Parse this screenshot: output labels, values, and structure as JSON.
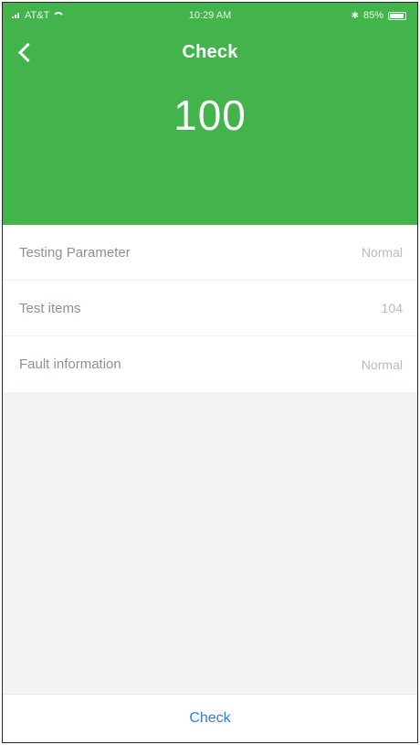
{
  "status_bar": {
    "carrier": "AT&T",
    "time": "10:29 AM",
    "battery": "85%",
    "bluetooth_icon": "bluetooth-icon",
    "wifi_icon": "wifi-icon",
    "battery_level": 0.85
  },
  "header": {
    "back_icon": "chevron-left-icon",
    "title": "Check",
    "score": "100",
    "background_color": "#43b34c"
  },
  "list": {
    "items": [
      {
        "label": "Testing Parameter",
        "value": "Normal"
      },
      {
        "label": "Test items",
        "value": "104"
      },
      {
        "label": "Fault information",
        "value": "Normal"
      }
    ]
  },
  "footer": {
    "button_label": "Check",
    "button_color": "#2f7fdc"
  }
}
